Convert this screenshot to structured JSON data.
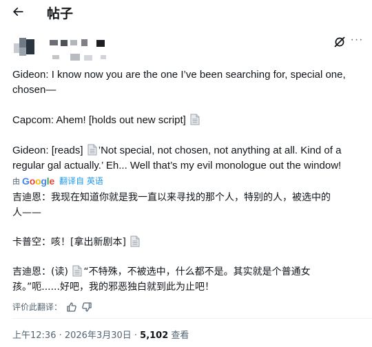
{
  "header": {
    "title": "帖子"
  },
  "post": {
    "lines": {
      "l1a": "Gideon: I know now you are the one I’ve been searching for, special one,",
      "l1b": "chosen—",
      "l2": "Capcom: Ahem!  [holds out new script]",
      "l3a_pre": "Gideon: [reads]",
      "l3a_post": "’Not special, not chosen, not anything at all. Kind of a",
      "l3b": "regular gal actually.’ Eh... Well that’s my evil monologue out the window!"
    },
    "translation": {
      "by_label": "由",
      "google": [
        "G",
        "o",
        "o",
        "g",
        "l",
        "e"
      ],
      "translated_from": "翻译自 英语",
      "z1a": "吉迪恩：我现在知道你就是我一直以来寻找的那个人，特别的人，被选中的",
      "z1b": "人——",
      "z2": "卡普空：咳！[拿出新剧本]",
      "z3a_pre": "吉迪恩：(读)",
      "z3a_post": "“不特殊，不被选中，什么都不是。其实就是个普通女",
      "z3b": "孩。”呃......好吧，我的邪恶独白就到此为止吧！"
    },
    "rate_label": "评价此翻译：",
    "meta": {
      "time": "上午12:36 · 2026年3月30日 · ",
      "views": "5,102",
      "views_label": " 查看"
    }
  },
  "icons": {
    "back": "arrow-left-icon",
    "grok": "grok-icon",
    "more": "more-horizontal-icon",
    "doc": "page-facing-up-icon",
    "thumb_up": "thumbs-up-icon",
    "thumb_down": "thumbs-down-icon"
  },
  "colors": {
    "text": "#0f1419",
    "secondary": "#536471",
    "link": "#1d9bf0"
  }
}
